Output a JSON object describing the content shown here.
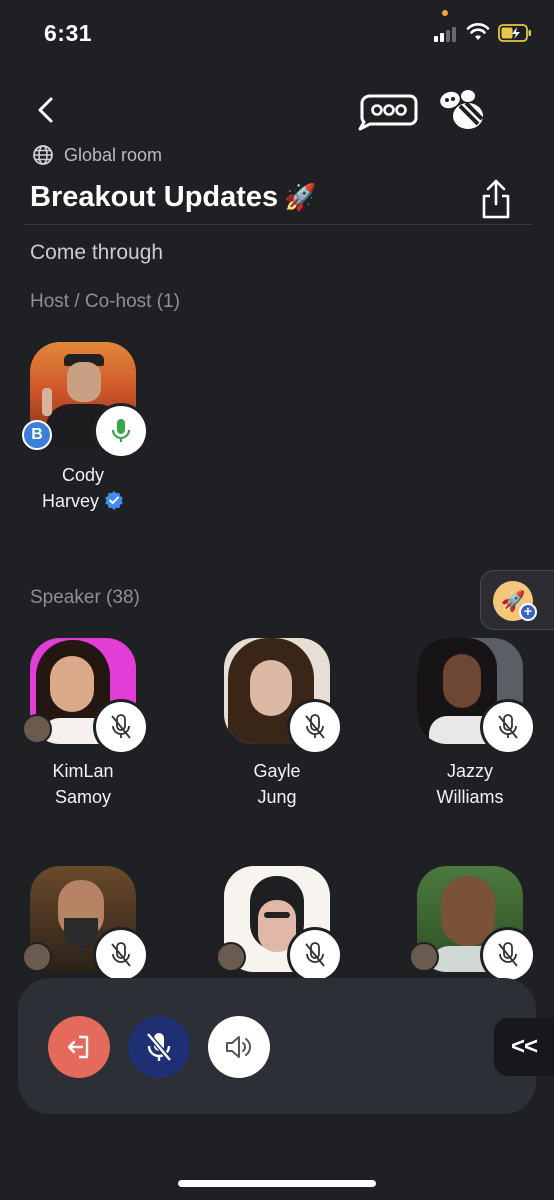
{
  "status_bar": {
    "time": "6:31"
  },
  "header": {
    "back_icon": "chevron-left-icon",
    "chat_icon": "chat-bubble-icon",
    "bee_icon": "bee-icon",
    "room_type": "Global room",
    "title": "Breakout Updates",
    "title_emoji": "🚀",
    "share_icon": "share-icon"
  },
  "description": "Come through",
  "hosts": {
    "label": "Host / Co-host (1)",
    "members": [
      {
        "first": "Cody",
        "last": "Harvey",
        "verified": true,
        "mic": "on",
        "badge": "B"
      }
    ]
  },
  "speakers": {
    "label": "Speaker (38)",
    "members": [
      {
        "first": "KimLan",
        "last": "Samoy",
        "mic": "off"
      },
      {
        "first": "Gayle",
        "last": "Jung",
        "mic": "off"
      },
      {
        "first": "Jazzy",
        "last": "Williams",
        "mic": "off"
      },
      {
        "first": "",
        "last": "",
        "mic": "off"
      },
      {
        "first": "",
        "last": "",
        "mic": "off"
      },
      {
        "first": "",
        "last": "",
        "mic": "off"
      }
    ]
  },
  "side_float": {
    "emoji": "🚀",
    "plus": "+"
  },
  "controls": {
    "leave_icon": "leave-icon",
    "mute_icon": "mic-off-icon",
    "speaker_icon": "speaker-icon",
    "collapse_label": "<<"
  },
  "colors": {
    "background": "#1f2024",
    "leave": "#e46a5b",
    "mute": "#1f2f73",
    "mic_on": "#3aa64b",
    "verified": "#3d8ef0"
  }
}
